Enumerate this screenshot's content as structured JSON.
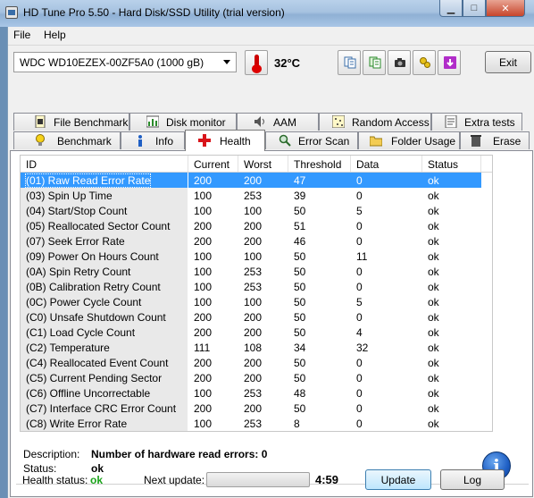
{
  "window": {
    "title": "HD Tune Pro 5.50 - Hard Disk/SSD Utility (trial version)"
  },
  "menu": [
    {
      "label": "File"
    },
    {
      "label": "Help"
    }
  ],
  "toolbar": {
    "drive": "WDC WD10EZEX-00ZF5A0 (1000 gB)",
    "temperature": "32°C",
    "exit_label": "Exit",
    "icons": [
      "copy-text-icon",
      "copy-info-icon",
      "screenshot-camera-icon",
      "options-icon",
      "save-icon"
    ]
  },
  "tabs_top": [
    {
      "label": "File Benchmark",
      "icon": "file-benchmark-icon"
    },
    {
      "label": "Disk monitor",
      "icon": "disk-monitor-icon"
    },
    {
      "label": "AAM",
      "icon": "speaker-icon"
    },
    {
      "label": "Random Access",
      "icon": "random-access-icon"
    },
    {
      "label": "Extra tests",
      "icon": "extra-tests-icon"
    }
  ],
  "tabs_bottom": [
    {
      "label": "Benchmark",
      "icon": "lightbulb-icon"
    },
    {
      "label": "Info",
      "icon": "info-icon"
    },
    {
      "label": "Health",
      "icon": "red-cross-icon",
      "active": true
    },
    {
      "label": "Error Scan",
      "icon": "magnifier-icon"
    },
    {
      "label": "Folder Usage",
      "icon": "folder-icon"
    },
    {
      "label": "Erase",
      "icon": "trash-icon"
    }
  ],
  "grid": {
    "columns": [
      "ID",
      "Current",
      "Worst",
      "Threshold",
      "Data",
      "Status"
    ],
    "rows": [
      [
        "(01) Raw Read Error Rate",
        "200",
        "200",
        "47",
        "0",
        "ok"
      ],
      [
        "(03) Spin Up Time",
        "100",
        "253",
        "39",
        "0",
        "ok"
      ],
      [
        "(04) Start/Stop Count",
        "100",
        "100",
        "50",
        "5",
        "ok"
      ],
      [
        "(05) Reallocated Sector Count",
        "200",
        "200",
        "51",
        "0",
        "ok"
      ],
      [
        "(07) Seek Error Rate",
        "200",
        "200",
        "46",
        "0",
        "ok"
      ],
      [
        "(09) Power On Hours Count",
        "100",
        "100",
        "50",
        "11",
        "ok"
      ],
      [
        "(0A) Spin Retry Count",
        "100",
        "253",
        "50",
        "0",
        "ok"
      ],
      [
        "(0B) Calibration Retry Count",
        "100",
        "253",
        "50",
        "0",
        "ok"
      ],
      [
        "(0C) Power Cycle Count",
        "100",
        "100",
        "50",
        "5",
        "ok"
      ],
      [
        "(C0) Unsafe Shutdown Count",
        "200",
        "200",
        "50",
        "0",
        "ok"
      ],
      [
        "(C1) Load Cycle Count",
        "200",
        "200",
        "50",
        "4",
        "ok"
      ],
      [
        "(C2) Temperature",
        "111",
        "108",
        "34",
        "32",
        "ok"
      ],
      [
        "(C4) Reallocated Event Count",
        "200",
        "200",
        "50",
        "0",
        "ok"
      ],
      [
        "(C5) Current Pending Sector",
        "200",
        "200",
        "50",
        "0",
        "ok"
      ],
      [
        "(C6) Offline Uncorrectable",
        "100",
        "253",
        "48",
        "0",
        "ok"
      ],
      [
        "(C7) Interface CRC Error Count",
        "200",
        "200",
        "50",
        "0",
        "ok"
      ],
      [
        "(C8) Write Error Rate",
        "100",
        "253",
        "8",
        "0",
        "ok"
      ]
    ],
    "selected_row": 0
  },
  "details": {
    "description_label": "Description:",
    "description_value": "Number of hardware read errors: 0",
    "status_label": "Status:",
    "status_value": "ok"
  },
  "statusbar": {
    "health_label": "Health status:",
    "health_value": "ok",
    "health_color": "#1aa31a",
    "next_update_label": "Next update:",
    "progress_fraction": 0.0,
    "countdown": "4:59",
    "update_label": "Update",
    "log_label": "Log"
  }
}
